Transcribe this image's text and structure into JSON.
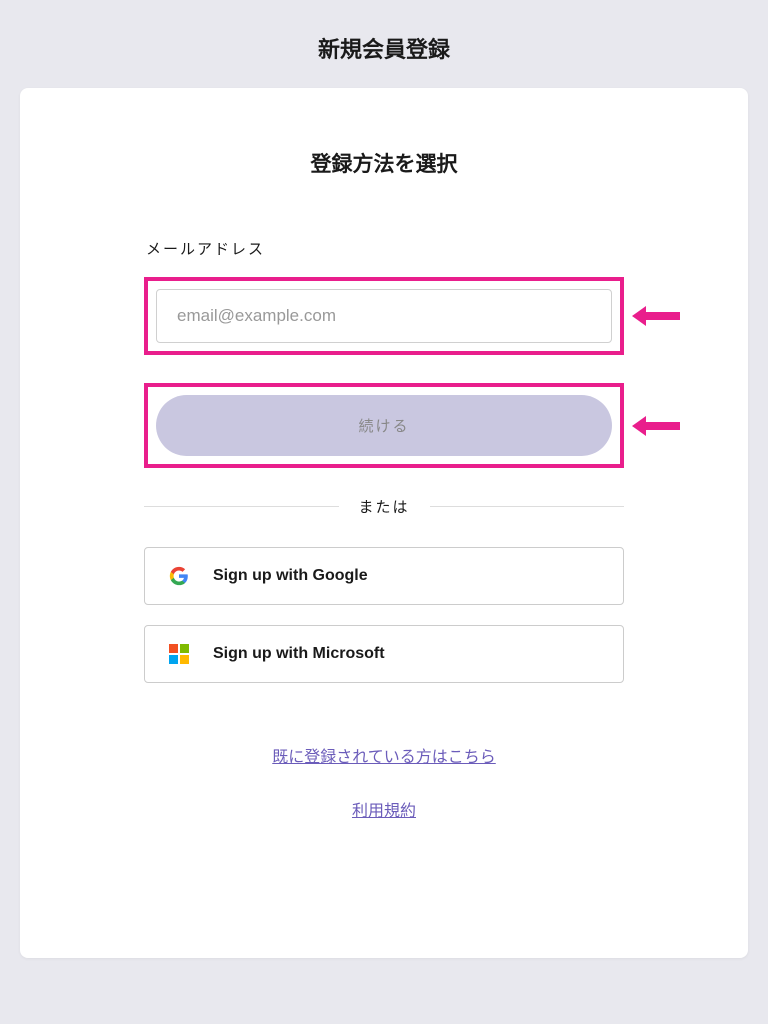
{
  "page": {
    "title": "新規会員登録"
  },
  "card": {
    "title": "登録方法を選択"
  },
  "form": {
    "email_label": "メールアドレス",
    "email_placeholder": "email@example.com",
    "continue_label": "続ける",
    "divider_text": "または"
  },
  "social": {
    "google_label": "Sign up with Google",
    "microsoft_label": "Sign up with Microsoft"
  },
  "links": {
    "existing_user": "既に登録されている方はこちら",
    "terms": "利用規約"
  },
  "colors": {
    "highlight": "#e91e8c",
    "button_bg": "#c9c7e0",
    "link": "#6b5cba"
  }
}
